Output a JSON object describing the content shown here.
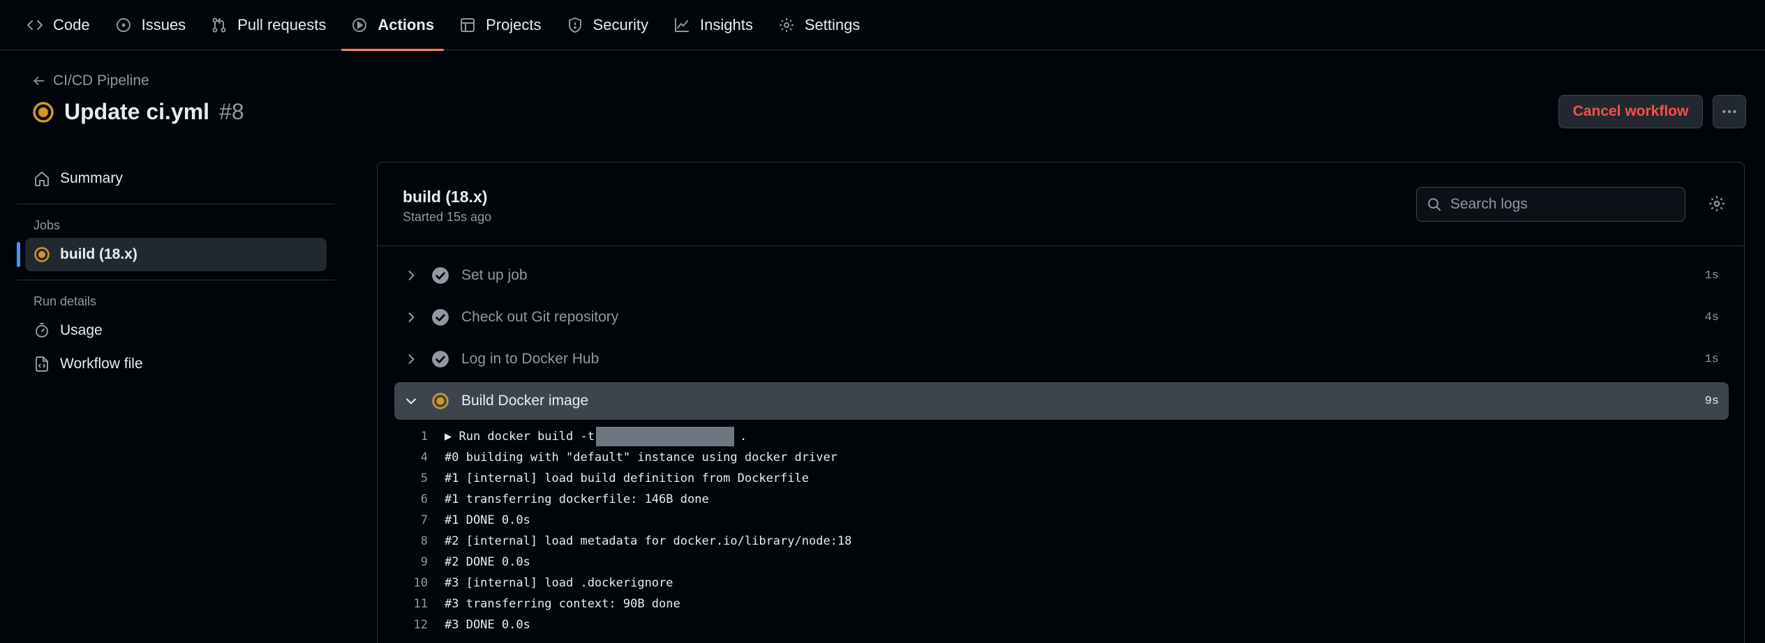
{
  "nav": {
    "tabs": [
      {
        "label": "Code",
        "icon": "code-icon"
      },
      {
        "label": "Issues",
        "icon": "issue-icon"
      },
      {
        "label": "Pull requests",
        "icon": "pull-request-icon"
      },
      {
        "label": "Actions",
        "icon": "play-icon",
        "active": true
      },
      {
        "label": "Projects",
        "icon": "table-icon"
      },
      {
        "label": "Security",
        "icon": "shield-icon"
      },
      {
        "label": "Insights",
        "icon": "graph-icon"
      },
      {
        "label": "Settings",
        "icon": "gear-icon"
      }
    ]
  },
  "header": {
    "back_label": "CI/CD Pipeline",
    "title": "Update ci.yml",
    "run_number": "#8",
    "cancel_label": "Cancel workflow"
  },
  "sidebar": {
    "summary_label": "Summary",
    "jobs_heading": "Jobs",
    "job_label": "build (18.x)",
    "run_details_heading": "Run details",
    "usage_label": "Usage",
    "workflow_file_label": "Workflow file"
  },
  "job": {
    "title": "build (18.x)",
    "subtitle": "Started 15s ago",
    "search_placeholder": "Search logs",
    "steps": [
      {
        "label": "Set up job",
        "duration": "1s",
        "status": "success"
      },
      {
        "label": "Check out Git repository",
        "duration": "4s",
        "status": "success"
      },
      {
        "label": "Log in to Docker Hub",
        "duration": "1s",
        "status": "success"
      },
      {
        "label": "Build Docker image",
        "duration": "9s",
        "status": "in-progress",
        "expanded": true
      }
    ],
    "log": {
      "first_prefix": "Run docker build -t",
      "first_suffix": ".",
      "lines": [
        {
          "n": "1",
          "text": ""
        },
        {
          "n": "4",
          "text": "#0 building with \"default\" instance using docker driver"
        },
        {
          "n": "5",
          "text": "#1 [internal] load build definition from Dockerfile"
        },
        {
          "n": "6",
          "text": "#1 transferring dockerfile: 146B done"
        },
        {
          "n": "7",
          "text": "#1 DONE 0.0s"
        },
        {
          "n": "8",
          "text": "#2 [internal] load metadata for docker.io/library/node:18"
        },
        {
          "n": "9",
          "text": "#2 DONE 0.0s"
        },
        {
          "n": "10",
          "text": "#3 [internal] load .dockerignore"
        },
        {
          "n": "11",
          "text": "#3 transferring context: 90B done"
        },
        {
          "n": "12",
          "text": "#3 DONE 0.0s"
        }
      ]
    }
  },
  "colors": {
    "accent_tab": "#f78166",
    "in_progress": "#d29922",
    "danger": "#f85149",
    "selected_bar": "#4493f8"
  }
}
